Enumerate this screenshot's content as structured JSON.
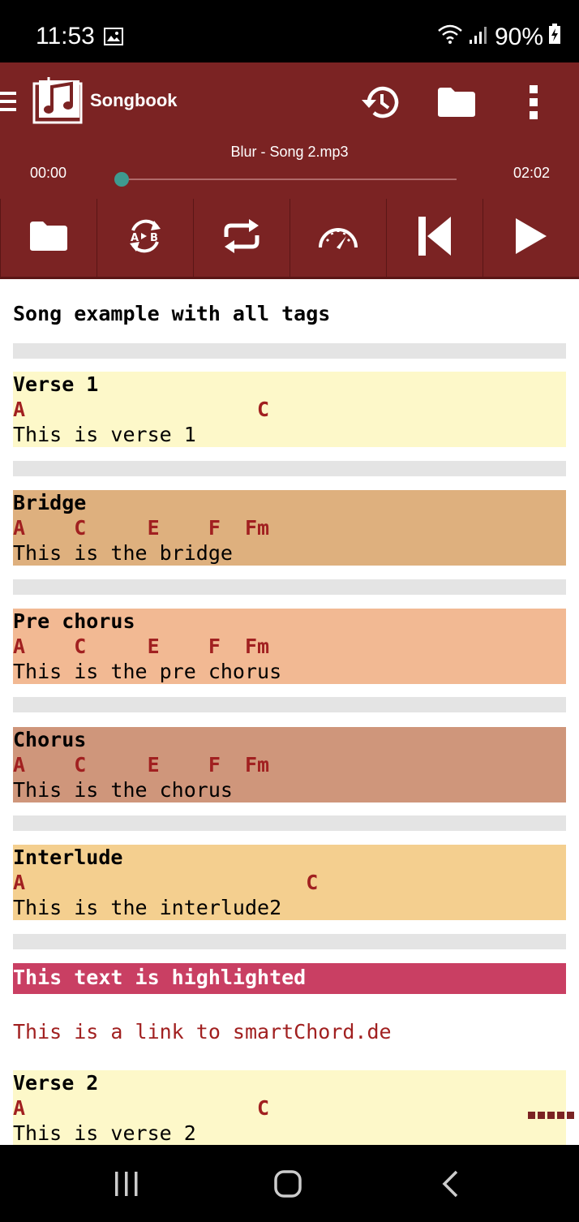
{
  "status": {
    "time": "11:53",
    "battery": "90%"
  },
  "app": {
    "title": "Songbook",
    "icons": [
      "menu-icon",
      "songbook-logo-icon",
      "history-icon",
      "folder-icon",
      "more-vert-icon"
    ]
  },
  "player": {
    "track": "Blur - Song 2.mp3",
    "current_time": "00:00",
    "total_time": "02:02",
    "progress": 0.0,
    "controls": [
      "folder-icon",
      "ab-repeat-icon",
      "repeat-icon",
      "speed-icon",
      "skip-previous-icon",
      "play-icon"
    ]
  },
  "song": {
    "title": "Song example with all tags",
    "sections": [
      {
        "name": "Verse 1",
        "chords": "A                   C",
        "lyric": "This is verse 1",
        "color": "#fdf8c9"
      },
      {
        "name": "Bridge",
        "chords": "A    C     E    F  Fm",
        "lyric": "This is the bridge",
        "color": "#deb07e"
      },
      {
        "name": "Pre chorus",
        "chords": "A    C     E    F  Fm",
        "lyric": "This is the pre chorus",
        "color": "#f2b993"
      },
      {
        "name": "Chorus",
        "chords": "A    C     E    F  Fm",
        "lyric": "This is the chorus",
        "color": "#cf967b"
      },
      {
        "name": "Interlude",
        "chords": "A                       C",
        "lyric": "This is the interlude2",
        "color": "#f4cf8f"
      },
      {
        "name": "Verse 2",
        "chords": "A                   C",
        "lyric": "This is verse 2",
        "color": "#fdf8c9"
      }
    ],
    "highlight_text": "This text is highlighted",
    "highlight_color": "#c93f63",
    "link_text": "This is a link to smartChord.de"
  },
  "colors": {
    "primary": "#7b2323",
    "chord": "#a12020",
    "separator": "#e4e4e4",
    "seek_thumb": "#3e9a90"
  }
}
